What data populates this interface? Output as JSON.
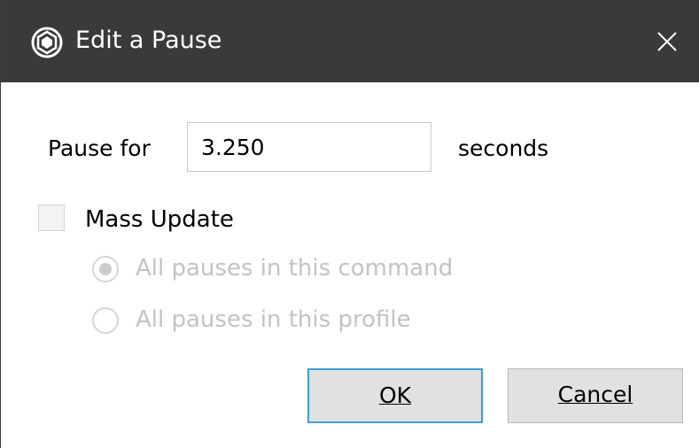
{
  "window": {
    "title": "Edit a Pause",
    "close_glyph": "✕",
    "icon": "app-logo-icon"
  },
  "pause": {
    "label": "Pause for",
    "value": "3.250",
    "unit": "seconds"
  },
  "mass_update": {
    "label": "Mass Update",
    "checked": false,
    "options": [
      {
        "label": "All pauses in this command",
        "selected": true,
        "enabled": false
      },
      {
        "label": "All pauses in this profile",
        "selected": false,
        "enabled": false
      }
    ]
  },
  "buttons": {
    "ok_label": "OK",
    "cancel_label": "Cancel"
  },
  "colors": {
    "titlebar": "#3a3a3a",
    "default_button_border": "#3c9ed9",
    "disabled_text": "#c3c3c3"
  }
}
